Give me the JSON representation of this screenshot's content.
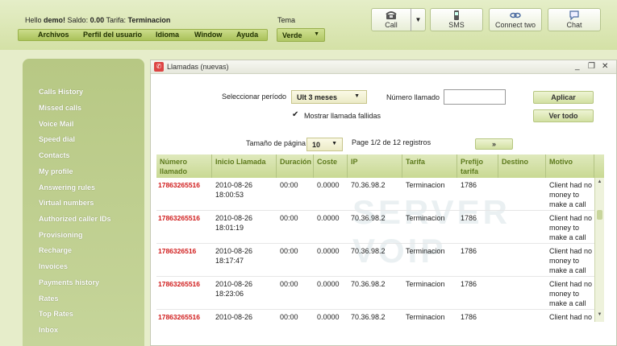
{
  "header": {
    "greeting_prefix": "Hello",
    "user": "demo!",
    "saldo_label": "Saldo:",
    "saldo_value": "0.00",
    "tarifa_label": "Tarifa:",
    "tarifa_value": "Terminacion",
    "menu": [
      "Archivos",
      "Perfil del usuario",
      "Idioma",
      "Window",
      "Ayuda"
    ],
    "tema_label": "Tema",
    "tema_value": "Verde",
    "buttons": {
      "call": "Call",
      "sms": "SMS",
      "connect_two": "Connect two",
      "chat": "Chat"
    }
  },
  "sidebar": {
    "items": [
      "Calls History",
      "Missed calls",
      "Voice Mail",
      "Speed dial",
      "Contacts",
      "My profile",
      "Answering rules",
      "Virtual numbers",
      "Authorized caller IDs",
      "Provisioning",
      "Recharge",
      "Invoices",
      "Payments history",
      "Rates",
      "Top Rates",
      "Inbox"
    ]
  },
  "window": {
    "title": "Llamadas (nuevas)",
    "controls": {
      "minimize": "_",
      "restore": "❐",
      "close": "✕"
    },
    "filters": {
      "period_label": "Seleccionar período",
      "period_value": "Ult 3 meses",
      "number_label": "Número llamado",
      "number_value": "",
      "apply_button": "Aplicar",
      "view_all_button": "Ver todo",
      "failed_checkbox_label": "Mostrar llamada fallidas",
      "failed_checked": true
    },
    "paging": {
      "page_size_label": "Tamaño de página",
      "page_size_value": "10",
      "page_info": "Page 1/2 de 12 registros",
      "next_button": "»"
    },
    "table": {
      "columns": [
        "Número llamado",
        "Inicio Llamada",
        "Duración",
        "Coste",
        "IP",
        "Tarifa",
        "Prefijo tarifa",
        "Destino",
        "Motivo"
      ],
      "rows": [
        {
          "numero": "17863265516",
          "inicio": "2010-08-26 18:00:53",
          "duracion": "00:00",
          "coste": "0.0000",
          "ip": "70.36.98.2",
          "tarifa": "Terminacion",
          "prefijo": "1786",
          "destino": "",
          "motivo": "Client had no money to make a call"
        },
        {
          "numero": "17863265516",
          "inicio": "2010-08-26 18:01:19",
          "duracion": "00:00",
          "coste": "0.0000",
          "ip": "70.36.98.2",
          "tarifa": "Terminacion",
          "prefijo": "1786",
          "destino": "",
          "motivo": "Client had no money to make a call"
        },
        {
          "numero": "1786326516",
          "inicio": "2010-08-26 18:17:47",
          "duracion": "00:00",
          "coste": "0.0000",
          "ip": "70.36.98.2",
          "tarifa": "Terminacion",
          "prefijo": "1786",
          "destino": "",
          "motivo": "Client had no money to make a call"
        },
        {
          "numero": "17863265516",
          "inicio": "2010-08-26 18:23:06",
          "duracion": "00:00",
          "coste": "0.0000",
          "ip": "70.36.98.2",
          "tarifa": "Terminacion",
          "prefijo": "1786",
          "destino": "",
          "motivo": "Client had no money to make a call"
        },
        {
          "numero": "17863265516",
          "inicio": "2010-08-26",
          "duracion": "00:00",
          "coste": "0.0000",
          "ip": "70.36.98.2",
          "tarifa": "Terminacion",
          "prefijo": "1786",
          "destino": "",
          "motivo": "Client had no"
        }
      ]
    },
    "watermark": "SERVER VOIP"
  }
}
